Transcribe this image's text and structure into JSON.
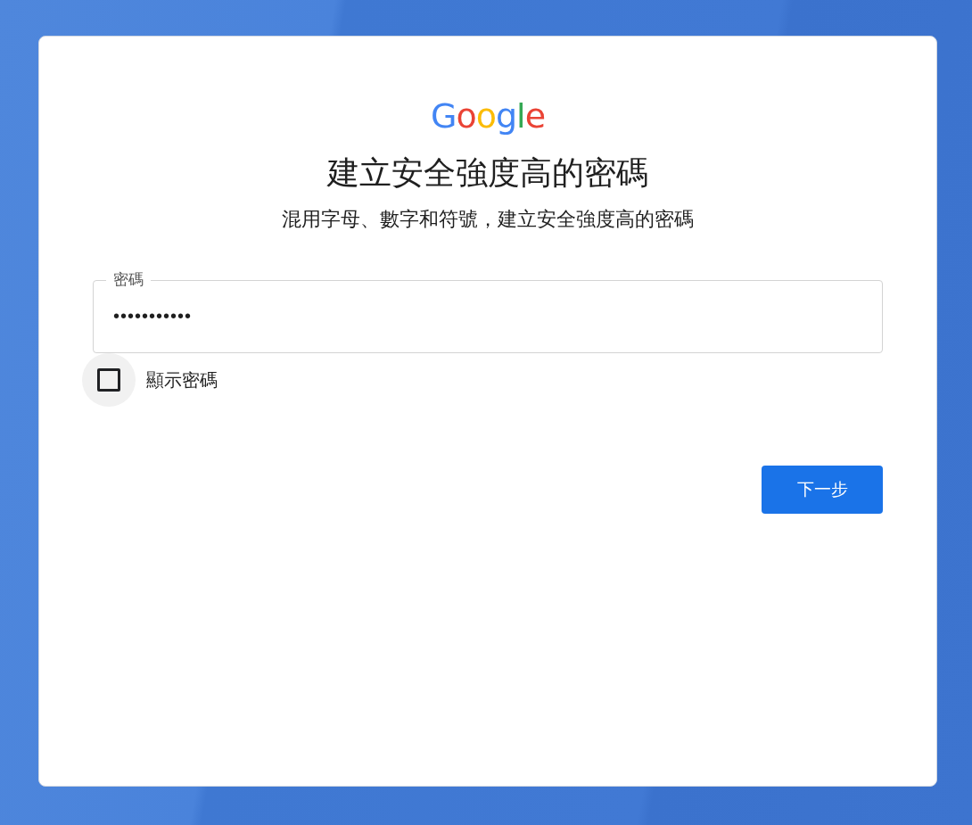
{
  "logo": "Google",
  "title": "建立安全強度高的密碼",
  "subtitle": "混用字母、數字和符號，建立安全強度高的密碼",
  "password_field": {
    "label": "密碼",
    "value": "•••••••••••"
  },
  "show_password": {
    "label": "顯示密碼",
    "checked": false
  },
  "next_button": "下一步"
}
